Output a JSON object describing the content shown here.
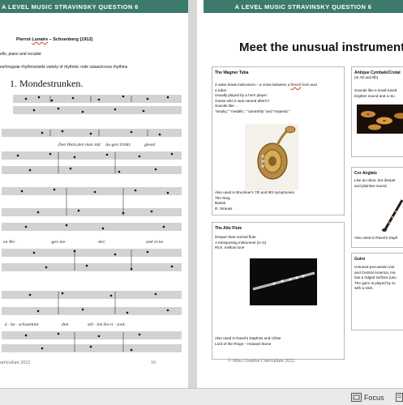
{
  "left_page": {
    "banner": "A LEVEL MUSIC STRAVINSKY QUESTION 6",
    "piece_title_prefix": "Pierrot ",
    "piece_title_underlined": "Lunaire",
    "piece_title_suffix": " – Schoenberg (1912)",
    "line_instruments": "ello, piano and vocalist",
    "line_rhythms": "es/irregular rhythms/wide variety of rhythmic note values/cross rhythms",
    "score_heading": "1. Mondestrunken.",
    "lyrics": [
      "Den Wein,den man mit",
      "Au-gen trinkt,",
      "giesst",
      "en   Wo-",
      "-gen  nie-",
      "-der,",
      "und ei-ne",
      "ä - be - schwemmt",
      "den",
      "stil - len  Ho-ri - zont."
    ],
    "footer_left": "urriculum 2022",
    "footer_right": "16"
  },
  "right_page": {
    "banner": "A LEVEL MUSIC STRAVINSKY QUESTION 6",
    "title": "Meet the unusual instrument",
    "wagner_tuba": {
      "title": "The Wagner Tuba",
      "lines": [
        "4 valve brass instrument – a cross between a ",
        "french",
        " horn and",
        "a tuba!",
        "Usually played by a horn player",
        "Guess who it was named after!!!!",
        "Sounds like …",
        "“smoky,” “metallic,” “unearthly” and “majestic.”"
      ],
      "used_in": [
        "Also used in Bruckner's 7th and 9th symphonies",
        "The Ring",
        "Bartok",
        "R. Strauss"
      ]
    },
    "alto_flute": {
      "title": "The Alto Flute",
      "lines": [
        "Deeper than normal flute",
        "A transposing instrument (in G)",
        "Rich, mellow tone"
      ],
      "used_in": [
        "Also used in Ravel's Daphnis and Chloe",
        "Lord of the Rings – Howard Stone"
      ]
    },
    "cymbals": {
      "title": "Antique Cymbals/Crotal",
      "lines": [
        "(In Ab and Bb)",
        "Sounds like a small tuned",
        "brighter sound and a mu"
      ]
    },
    "cor_anglais": {
      "title": "Cor Anglais",
      "lines": [
        "Like an oboe, but deeper",
        "and plaintive sound."
      ],
      "used_in": "Also used in Ravel's Daph"
    },
    "guiro": {
      "title": "Guiro",
      "lines": [
        "Untuned percussion inst",
        "and Central America, ma",
        "has a ridged surface (usu",
        "The guiro is played by sc",
        "with a stick."
      ]
    },
    "footer": "© Miss Creative Curriculum 2022"
  },
  "statusbar": {
    "focus_label": "Focus"
  }
}
